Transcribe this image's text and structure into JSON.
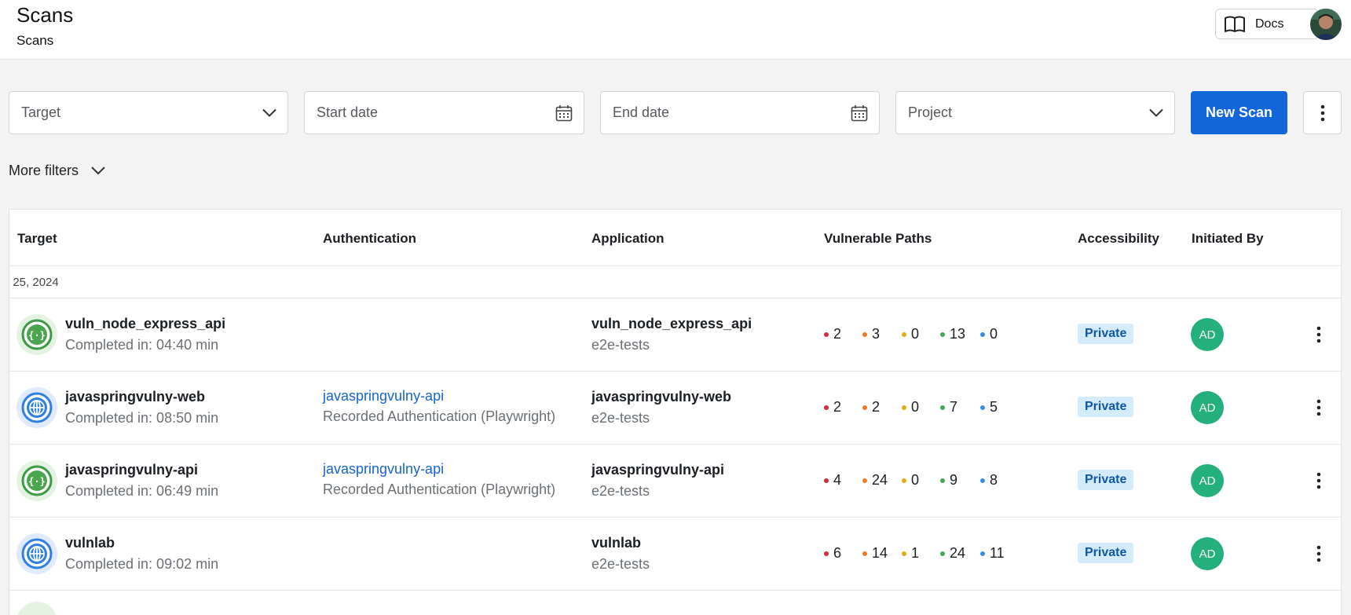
{
  "header": {
    "title": "Scans",
    "breadcrumb": "Scans",
    "docs_label": "Docs"
  },
  "filters": {
    "target_placeholder": "Target",
    "start_date_placeholder": "Start date",
    "end_date_placeholder": "End date",
    "project_placeholder": "Project",
    "new_scan_label": "New Scan",
    "more_filters_label": "More filters"
  },
  "table": {
    "columns": [
      "Target",
      "Authentication",
      "Application",
      "Vulnerable Paths",
      "Accessibility",
      "Initiated By"
    ],
    "group_label": ": 25, 2024",
    "rows": [
      {
        "target": "vuln_node_express_api",
        "completed": "Completed in: 04:40 min",
        "type": "api",
        "auth_link": "",
        "auth_sub": "",
        "app_name": "vuln_node_express_api",
        "app_sub": "e2e-tests",
        "paths": [
          "2",
          "3",
          "0",
          "13",
          "0"
        ],
        "accessibility": "Private",
        "initiated_by": "AD"
      },
      {
        "target": "javaspringvulny-web",
        "completed": "Completed in: 08:50 min",
        "type": "web",
        "auth_link": "javaspringvulny-api",
        "auth_sub": "Recorded Authentication (Playwright)",
        "app_name": "javaspringvulny-web",
        "app_sub": "e2e-tests",
        "paths": [
          "2",
          "2",
          "0",
          "7",
          "5"
        ],
        "accessibility": "Private",
        "initiated_by": "AD"
      },
      {
        "target": "javaspringvulny-api",
        "completed": "Completed in: 06:49 min",
        "type": "api",
        "auth_link": "javaspringvulny-api",
        "auth_sub": "Recorded Authentication (Playwright)",
        "app_name": "javaspringvulny-api",
        "app_sub": "e2e-tests",
        "paths": [
          "4",
          "24",
          "0",
          "9",
          "8"
        ],
        "accessibility": "Private",
        "initiated_by": "AD"
      },
      {
        "target": "vulnlab",
        "completed": "Completed in: 09:02 min",
        "type": "web",
        "auth_link": "",
        "auth_sub": "",
        "app_name": "vulnlab",
        "app_sub": "e2e-tests",
        "paths": [
          "6",
          "14",
          "1",
          "24",
          "11"
        ],
        "accessibility": "Private",
        "initiated_by": "AD"
      }
    ]
  },
  "severity_colors": {
    "critical": "#d62c3a",
    "high": "#ec7a23",
    "medium": "#e4ab10",
    "low": "#3fa855",
    "info": "#3b8bea"
  },
  "colors": {
    "primary": "#1366d9",
    "link": "#1765c9",
    "avatar": "#23b07c",
    "badge_bg": "#d4ebfb"
  },
  "icons": {
    "docs": "book-icon",
    "calendar": "calendar-icon",
    "dropdown": "chevron-down-icon",
    "menu": "kebab-icon",
    "api_target": "api-braces-icon",
    "web_target": "globe-icon"
  }
}
